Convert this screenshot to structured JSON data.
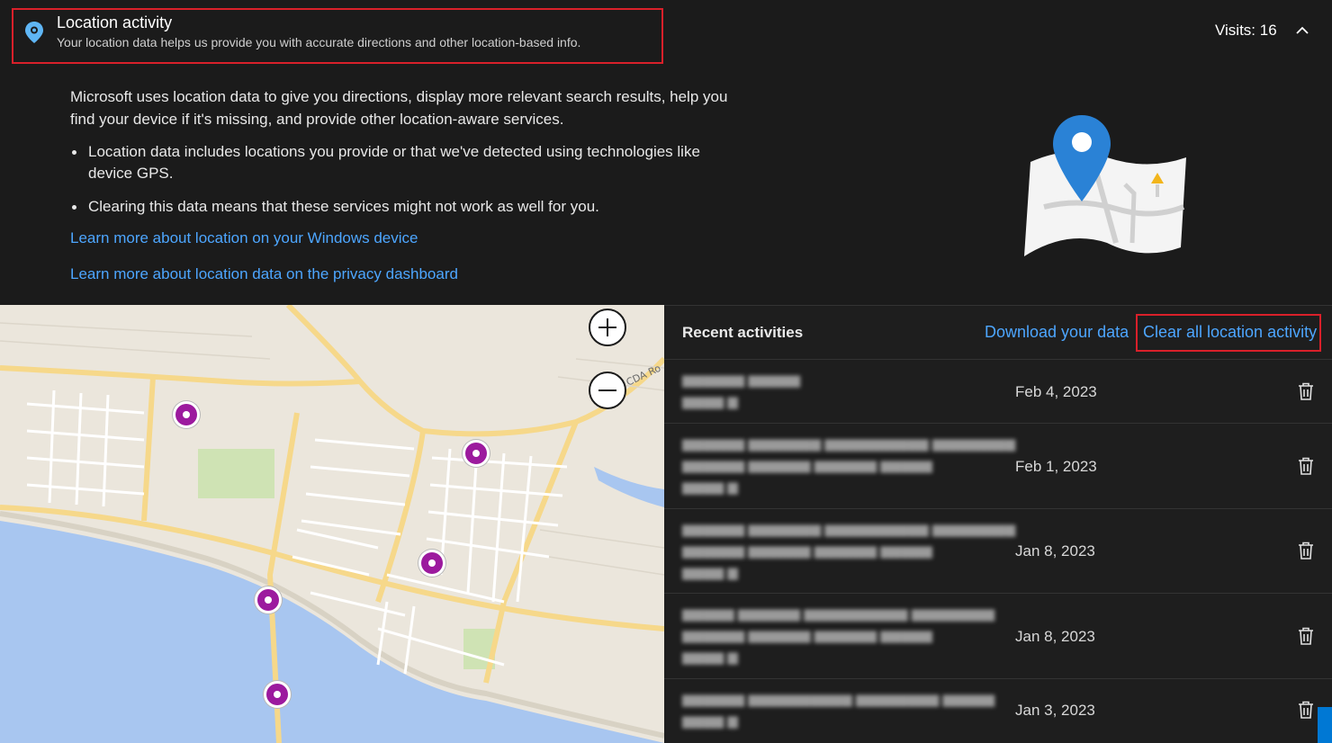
{
  "header": {
    "title": "Location activity",
    "subtitle": "Your location data helps us provide you with accurate directions and other location-based info.",
    "visits": "Visits: 16"
  },
  "description": {
    "intro": "Microsoft uses location data to give you directions, display more relevant search results, help you find your device if it's missing, and provide other location-aware services.",
    "bullets": [
      "Location data includes locations you provide or that we've detected using technologies like device GPS.",
      "Clearing this data means that these services might not work as well for you."
    ],
    "link_windows": "Learn more about location on your Windows device",
    "link_privacy": "Learn more about location data on the privacy dashboard"
  },
  "map": {
    "road_label": "CDA Ro"
  },
  "activities": {
    "title": "Recent activities",
    "download_label": "Download your data",
    "clear_label": "Clear all location activity",
    "rows": [
      {
        "date": "Feb 4, 2023"
      },
      {
        "date": "Feb 1, 2023"
      },
      {
        "date": "Jan 8, 2023"
      },
      {
        "date": "Jan 8, 2023"
      },
      {
        "date": "Jan 3, 2023"
      }
    ]
  },
  "colors": {
    "accent_link": "#4da6ff",
    "highlight_box": "#d9202a",
    "pin": "#9c1a9e",
    "background": "#1b1b1b"
  }
}
